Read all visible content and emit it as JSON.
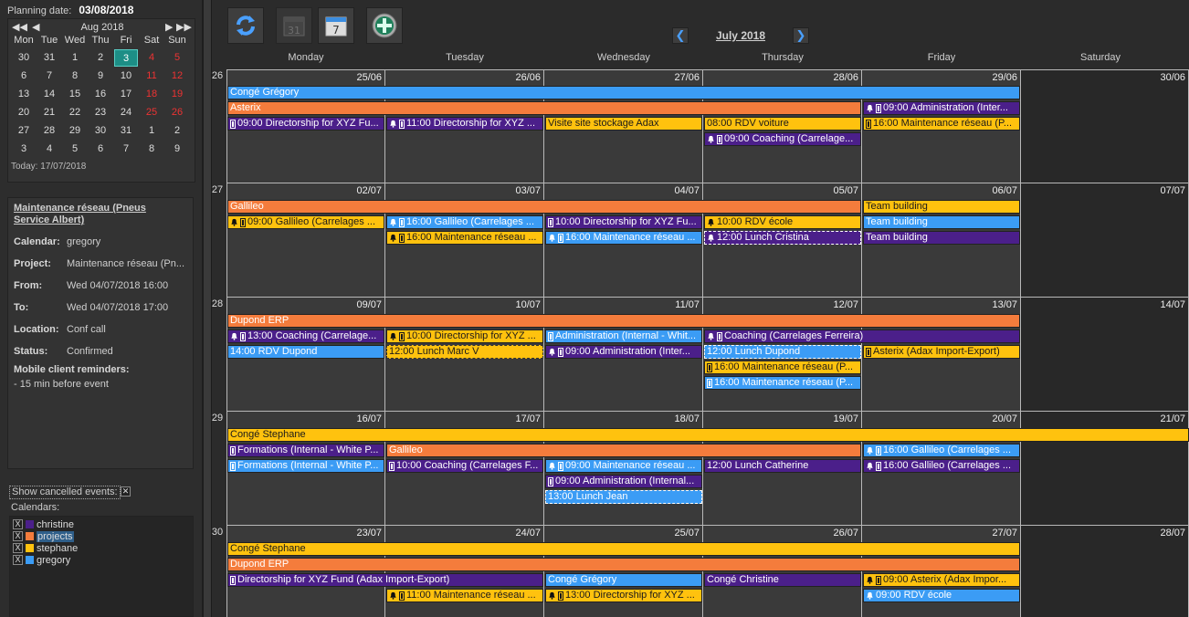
{
  "colors": {
    "christine": "#4b1f8a",
    "projects": "#f47c3c",
    "stephane": "#ffc20e",
    "gregory": "#3b9cf5"
  },
  "left": {
    "planning_label": "Planning date:",
    "planning_date": "03/08/2018",
    "month": "Aug 2018",
    "nav": {
      "first": "◀◀",
      "prev": "◀",
      "next": "▶",
      "last": "▶▶"
    },
    "dow": [
      "Mon",
      "Tue",
      "Wed",
      "Thu",
      "Fri",
      "Sat",
      "Sun"
    ],
    "weeks": [
      [
        "30",
        "31",
        "1",
        "2",
        "3",
        "4",
        "5"
      ],
      [
        "6",
        "7",
        "8",
        "9",
        "10",
        "11",
        "12"
      ],
      [
        "13",
        "14",
        "15",
        "16",
        "17",
        "18",
        "19"
      ],
      [
        "20",
        "21",
        "22",
        "23",
        "24",
        "25",
        "26"
      ],
      [
        "27",
        "28",
        "29",
        "30",
        "31",
        "1",
        "2"
      ],
      [
        "3",
        "4",
        "5",
        "6",
        "7",
        "8",
        "9"
      ]
    ],
    "today": "Today: 17/07/2018",
    "details": {
      "title": "Maintenance réseau (Pneus Service Albert)",
      "rows": [
        {
          "label": "Calendar:",
          "value": "gregory"
        },
        {
          "label": "Project:",
          "value": "Maintenance réseau (Pn..."
        },
        {
          "label": "From:",
          "value": "Wed 04/07/2018 16:00"
        },
        {
          "label": "To:",
          "value": "Wed 04/07/2018 17:00"
        },
        {
          "label": "Location:",
          "value": "Conf call"
        },
        {
          "label": "Status:",
          "value": "Confirmed"
        }
      ],
      "reminders_label": "Mobile client reminders:",
      "reminder": "- 15 min before event"
    },
    "show_cancelled": "Show cancelled events:",
    "calendars_label": "Calendars:",
    "calendars": [
      {
        "name": "christine",
        "color": "#4b1f8a",
        "check": "X"
      },
      {
        "name": "projects",
        "color": "#f47c3c",
        "check": "X"
      },
      {
        "name": "stephane",
        "color": "#ffc20e",
        "check": "X"
      },
      {
        "name": "gregory",
        "color": "#3b9cf5",
        "check": "X"
      }
    ]
  },
  "toolbar": {
    "refresh": "refresh-icon",
    "month": "calendar-month-icon",
    "week": "calendar-week-icon",
    "add": "add-icon",
    "month_icon_text": "31",
    "week_icon_text": "7",
    "add_symbol": "+"
  },
  "nav": {
    "title": "July 2018",
    "prev": "❮",
    "next": "❯"
  },
  "dow": [
    "Monday",
    "Tuesday",
    "Wednesday",
    "Thursday",
    "Friday",
    "Saturday"
  ],
  "weeks": [
    {
      "num": "26",
      "days": [
        "25/06",
        "26/06",
        "27/06",
        "28/06",
        "29/06",
        "30/06"
      ],
      "events": [
        {
          "row": 0,
          "start": 0,
          "span": 5,
          "text": "Congé Grégory",
          "cal": "gregory"
        },
        {
          "row": 1,
          "start": 0,
          "span": 4,
          "text": "Asterix",
          "cal": "projects"
        },
        {
          "row": 1,
          "start": 4,
          "span": 1,
          "text": "09:00 Administration (Inter...",
          "cal": "christine",
          "icons": [
            "bell",
            "bar"
          ]
        },
        {
          "row": 2,
          "start": 0,
          "span": 1,
          "text": "09:00 Directorship for XYZ Fu...",
          "cal": "christine",
          "icons": [
            "bar"
          ]
        },
        {
          "row": 2,
          "start": 1,
          "span": 1,
          "text": "11:00 Directorship for XYZ ...",
          "cal": "christine",
          "icons": [
            "bell",
            "bar"
          ]
        },
        {
          "row": 2,
          "start": 2,
          "span": 1,
          "text": "Visite site stockage Adax",
          "cal": "stephane"
        },
        {
          "row": 2,
          "start": 3,
          "span": 1,
          "text": "08:00 RDV voiture",
          "cal": "stephane"
        },
        {
          "row": 2,
          "start": 4,
          "span": 1,
          "text": "16:00 Maintenance réseau (P...",
          "cal": "stephane",
          "icons": [
            "bar"
          ]
        },
        {
          "row": 3,
          "start": 3,
          "span": 1,
          "text": "09:00 Coaching (Carrelage...",
          "cal": "christine",
          "icons": [
            "bell",
            "bar"
          ]
        }
      ]
    },
    {
      "num": "27",
      "days": [
        "02/07",
        "03/07",
        "04/07",
        "05/07",
        "06/07",
        "07/07"
      ],
      "events": [
        {
          "row": 0,
          "start": 0,
          "span": 4,
          "text": "Gallileo",
          "cal": "projects"
        },
        {
          "row": 0,
          "start": 4,
          "span": 1,
          "text": "Team building",
          "cal": "stephane"
        },
        {
          "row": 1,
          "start": 0,
          "span": 1,
          "text": "09:00 Gallileo (Carrelages ...",
          "cal": "stephane",
          "icons": [
            "bell",
            "bar"
          ]
        },
        {
          "row": 1,
          "start": 1,
          "span": 1,
          "text": "16:00 Gallileo (Carrelages ...",
          "cal": "gregory",
          "icons": [
            "bell",
            "bar"
          ]
        },
        {
          "row": 1,
          "start": 2,
          "span": 1,
          "text": "10:00 Directorship for XYZ Fu...",
          "cal": "christine",
          "icons": [
            "bar"
          ]
        },
        {
          "row": 1,
          "start": 3,
          "span": 1,
          "text": "10:00 RDV école",
          "cal": "stephane",
          "icons": [
            "bell"
          ]
        },
        {
          "row": 1,
          "start": 4,
          "span": 1,
          "text": "Team building",
          "cal": "gregory"
        },
        {
          "row": 2,
          "start": 1,
          "span": 1,
          "text": "16:00 Maintenance réseau ...",
          "cal": "stephane",
          "icons": [
            "bell",
            "bar"
          ]
        },
        {
          "row": 2,
          "start": 2,
          "span": 1,
          "text": "16:00 Maintenance réseau ...",
          "cal": "gregory",
          "icons": [
            "bell",
            "bar"
          ]
        },
        {
          "row": 2,
          "start": 3,
          "span": 1,
          "text": "12:00 Lunch Cristina",
          "cal": "christine",
          "icons": [
            "bell"
          ],
          "dash": true
        },
        {
          "row": 2,
          "start": 4,
          "span": 1,
          "text": "Team building",
          "cal": "christine"
        }
      ]
    },
    {
      "num": "28",
      "days": [
        "09/07",
        "10/07",
        "11/07",
        "12/07",
        "13/07",
        "14/07"
      ],
      "events": [
        {
          "row": 0,
          "start": 0,
          "span": 5,
          "text": "Dupond ERP",
          "cal": "projects"
        },
        {
          "row": 1,
          "start": 0,
          "span": 1,
          "text": "13:00 Coaching (Carrelage...",
          "cal": "christine",
          "icons": [
            "bell",
            "bar"
          ]
        },
        {
          "row": 1,
          "start": 1,
          "span": 1,
          "text": "10:00 Directorship for XYZ ...",
          "cal": "stephane",
          "icons": [
            "bell",
            "bar"
          ]
        },
        {
          "row": 1,
          "start": 2,
          "span": 1,
          "text": "Administration (Internal - Whit...",
          "cal": "gregory",
          "icons": [
            "bar"
          ]
        },
        {
          "row": 1,
          "start": 3,
          "span": 2,
          "text": "Coaching (Carrelages Ferreira)",
          "cal": "christine",
          "icons": [
            "bell",
            "bar"
          ]
        },
        {
          "row": 2,
          "start": 0,
          "span": 1,
          "text": "14:00 RDV Dupond",
          "cal": "gregory"
        },
        {
          "row": 2,
          "start": 1,
          "span": 1,
          "text": "12:00 Lunch Marc V",
          "cal": "stephane",
          "dash": true
        },
        {
          "row": 2,
          "start": 2,
          "span": 1,
          "text": "09:00 Administration (Inter...",
          "cal": "christine",
          "icons": [
            "bell",
            "bar"
          ]
        },
        {
          "row": 2,
          "start": 3,
          "span": 1,
          "text": "12:00 Lunch Dupond",
          "cal": "gregory",
          "dash": true
        },
        {
          "row": 2,
          "start": 4,
          "span": 1,
          "text": "Asterix (Adax Import-Export)",
          "cal": "stephane",
          "icons": [
            "bar"
          ]
        },
        {
          "row": 3,
          "start": 3,
          "span": 1,
          "text": "16:00 Maintenance réseau (P...",
          "cal": "stephane",
          "icons": [
            "bar"
          ]
        },
        {
          "row": 4,
          "start": 3,
          "span": 1,
          "text": "16:00 Maintenance réseau (P...",
          "cal": "gregory",
          "icons": [
            "bar"
          ]
        }
      ]
    },
    {
      "num": "29",
      "days": [
        "16/07",
        "17/07",
        "18/07",
        "19/07",
        "20/07",
        "21/07"
      ],
      "events": [
        {
          "row": 0,
          "start": 0,
          "span": 6,
          "text": "Congé Stephane",
          "cal": "stephane"
        },
        {
          "row": 1,
          "start": 0,
          "span": 1,
          "text": "Formations (Internal - White P...",
          "cal": "christine",
          "icons": [
            "bar"
          ]
        },
        {
          "row": 1,
          "start": 1,
          "span": 3,
          "text": "Gallileo",
          "cal": "projects"
        },
        {
          "row": 1,
          "start": 4,
          "span": 1,
          "text": "16:00 Gallileo (Carrelages ...",
          "cal": "gregory",
          "icons": [
            "bell",
            "bar"
          ]
        },
        {
          "row": 2,
          "start": 0,
          "span": 1,
          "text": "Formations (Internal - White P...",
          "cal": "gregory",
          "icons": [
            "bar"
          ]
        },
        {
          "row": 2,
          "start": 1,
          "span": 1,
          "text": "10:00 Coaching (Carrelages F...",
          "cal": "christine",
          "icons": [
            "bar"
          ]
        },
        {
          "row": 2,
          "start": 2,
          "span": 1,
          "text": "09:00 Maintenance réseau ...",
          "cal": "gregory",
          "icons": [
            "bell",
            "bar"
          ]
        },
        {
          "row": 2,
          "start": 3,
          "span": 1,
          "text": "12:00 Lunch Catherine",
          "cal": "christine"
        },
        {
          "row": 2,
          "start": 4,
          "span": 1,
          "text": "16:00 Gallileo (Carrelages ...",
          "cal": "christine",
          "icons": [
            "bell",
            "bar"
          ]
        },
        {
          "row": 3,
          "start": 2,
          "span": 1,
          "text": "09:00 Administration (Internal...",
          "cal": "christine",
          "icons": [
            "bar"
          ]
        },
        {
          "row": 4,
          "start": 2,
          "span": 1,
          "text": "13:00 Lunch Jean",
          "cal": "gregory",
          "dash": true
        }
      ]
    },
    {
      "num": "30",
      "days": [
        "23/07",
        "24/07",
        "25/07",
        "26/07",
        "27/07",
        "28/07"
      ],
      "events": [
        {
          "row": 0,
          "start": 0,
          "span": 5,
          "text": "Congé Stephane",
          "cal": "stephane"
        },
        {
          "row": 1,
          "start": 0,
          "span": 5,
          "text": "Dupond ERP",
          "cal": "projects"
        },
        {
          "row": 2,
          "start": 0,
          "span": 2,
          "text": "Directorship for XYZ Fund (Adax Import-Export)",
          "cal": "christine",
          "icons": [
            "bar"
          ]
        },
        {
          "row": 2,
          "start": 2,
          "span": 1,
          "text": "Congé Grégory",
          "cal": "gregory"
        },
        {
          "row": 2,
          "start": 3,
          "span": 1,
          "text": "Congé Christine",
          "cal": "christine"
        },
        {
          "row": 2,
          "start": 4,
          "span": 1,
          "text": "09:00 Asterix (Adax Impor...",
          "cal": "stephane",
          "icons": [
            "bell",
            "bar"
          ]
        },
        {
          "row": 3,
          "start": 1,
          "span": 1,
          "text": "11:00 Maintenance réseau ...",
          "cal": "stephane",
          "icons": [
            "bell",
            "bar"
          ]
        },
        {
          "row": 3,
          "start": 2,
          "span": 1,
          "text": "13:00 Directorship for XYZ ...",
          "cal": "stephane",
          "icons": [
            "bell",
            "bar"
          ]
        },
        {
          "row": 3,
          "start": 4,
          "span": 1,
          "text": "09:00 RDV école",
          "cal": "gregory",
          "icons": [
            "bell"
          ]
        }
      ]
    }
  ]
}
